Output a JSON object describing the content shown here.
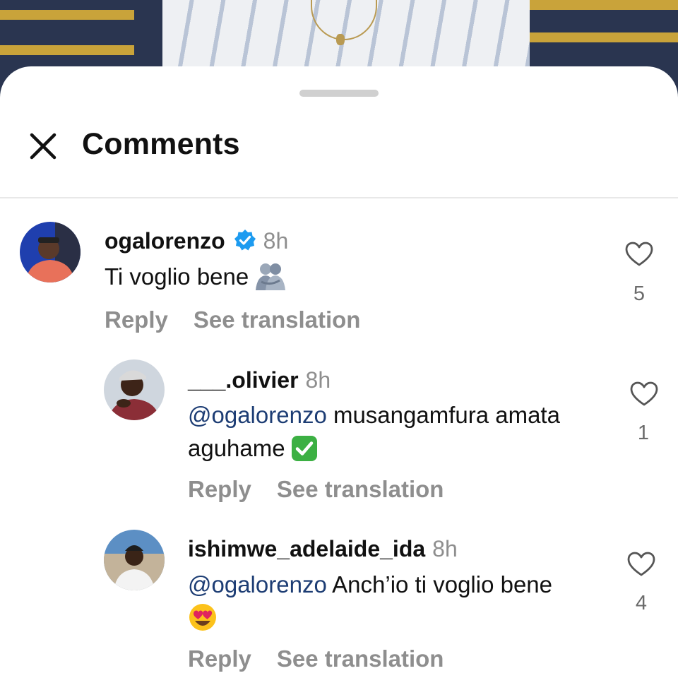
{
  "header": {
    "title": "Comments"
  },
  "colors": {
    "mention": "#1d3d74",
    "verified": "#1d9bf0",
    "muted": "#8e8e8e",
    "check": "#3cb043"
  },
  "comments": [
    {
      "username": "ogalorenzo",
      "verified": true,
      "time": "8h",
      "text": "Ti voglio bene",
      "emoji": "people-hugging-emoji",
      "likes": "5",
      "reply_label": "Reply",
      "translate_label": "See translation"
    },
    {
      "username": "___.olivier",
      "time": "8h",
      "mention": "@ogalorenzo",
      "text_line1": " musangamfura amata",
      "text_line2": "aguhame",
      "emoji": "check-mark-button-emoji",
      "likes": "1",
      "reply_label": "Reply",
      "translate_label": "See translation"
    },
    {
      "username": "ishimwe_adelaide_ida",
      "time": "8h",
      "mention": "@ogalorenzo",
      "text_line1": " Anch’io ti voglio bene",
      "emoji": "heart-eyes-emoji",
      "likes": "4",
      "reply_label": "Reply",
      "translate_label": "See translation"
    }
  ]
}
